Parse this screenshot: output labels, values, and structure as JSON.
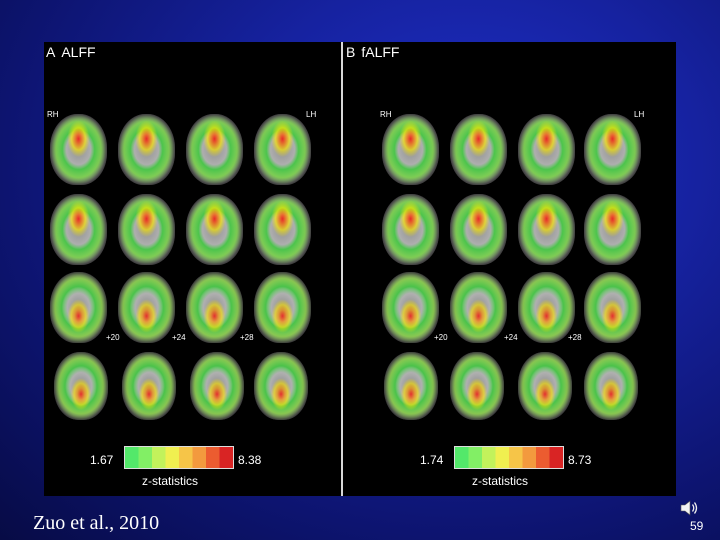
{
  "panels": [
    {
      "letter": "A",
      "title": "ALFF",
      "left_label": "RH",
      "right_label": "LH",
      "slice_labels": [
        "+20",
        "+24",
        "+28"
      ],
      "colorbar": {
        "min": "1.67",
        "max": "8.38",
        "title": "z-statistics"
      }
    },
    {
      "letter": "B",
      "title": "fALFF",
      "left_label": "RH",
      "right_label": "LH",
      "slice_labels": [
        "+20",
        "+24",
        "+28"
      ],
      "colorbar": {
        "min": "1.74",
        "max": "8.73",
        "title": "z-statistics"
      }
    }
  ],
  "colorbar_colors": [
    "#53e86a",
    "#82ef65",
    "#c2f25b",
    "#f0ef50",
    "#f6c548",
    "#f39a3e",
    "#ec5c30",
    "#d92424"
  ],
  "citation": "Zuo et al., 2010",
  "page_number": "59",
  "icons": {
    "audio": "speaker-icon"
  },
  "background_color": "#1622a0"
}
